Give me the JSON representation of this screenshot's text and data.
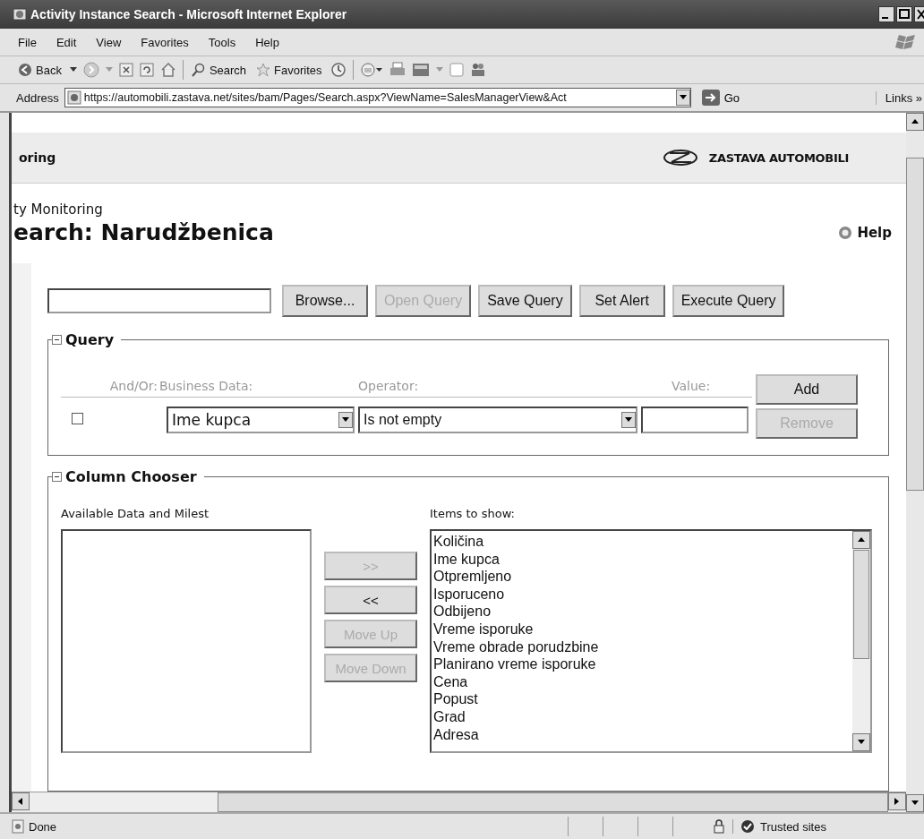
{
  "window": {
    "title": "Activity Instance Search - Microsoft Internet Explorer"
  },
  "menu": [
    "File",
    "Edit",
    "View",
    "Favorites",
    "Tools",
    "Help"
  ],
  "toolbar": {
    "back": "Back",
    "search": "Search",
    "favorites": "Favorites"
  },
  "address": {
    "label": "Address",
    "url": "https://automobili.zastava.net/sites/bam/Pages/Search.aspx?ViewName=SalesManagerView&Act",
    "go": "Go",
    "links": "Links »"
  },
  "page": {
    "header": "oring",
    "logo": "ZASTAVA AUTOMOBILI",
    "breadcrumb": "ty Monitoring",
    "title": "earch: Narudžbenica",
    "help": "Help"
  },
  "query_bar": {
    "buttons": [
      {
        "label": "Browse...",
        "disabled": false
      },
      {
        "label": "Open Query",
        "disabled": true
      },
      {
        "label": "Save Query",
        "disabled": false
      },
      {
        "label": "Set Alert",
        "disabled": false
      },
      {
        "label": "Execute Query",
        "disabled": false
      }
    ]
  },
  "query": {
    "legend": "Query",
    "expanded": true,
    "headers": [
      "And/Or:",
      "Business Data:",
      "Operator:",
      "Value:"
    ],
    "add": {
      "label": "Add",
      "disabled": false
    },
    "rows": [
      {
        "checked": false,
        "business_data": "Ime kupca",
        "operator": "Is not empty",
        "remove": {
          "label": "Remove",
          "disabled": true
        }
      }
    ]
  },
  "column_chooser": {
    "legend": "Column Chooser",
    "expanded": true,
    "available_label": "Available Data and Milest",
    "items_label": "Items to show:",
    "buttons": [
      {
        "label": ">>",
        "disabled": true
      },
      {
        "label": "<<",
        "disabled": false
      },
      {
        "label": "Move Up",
        "disabled": true
      },
      {
        "label": "Move Down",
        "disabled": true
      }
    ],
    "items": [
      "Količina",
      "Ime kupca",
      "Otpremljeno",
      "Isporuceno",
      "Odbijeno",
      "Vreme isporuke",
      "Vreme obrade porudzbine",
      "Planirano vreme isporuke",
      "Cena",
      "Popust",
      "Grad",
      "Adresa"
    ]
  },
  "status_bar": {
    "text": "Done",
    "zone": "Trusted sites"
  }
}
